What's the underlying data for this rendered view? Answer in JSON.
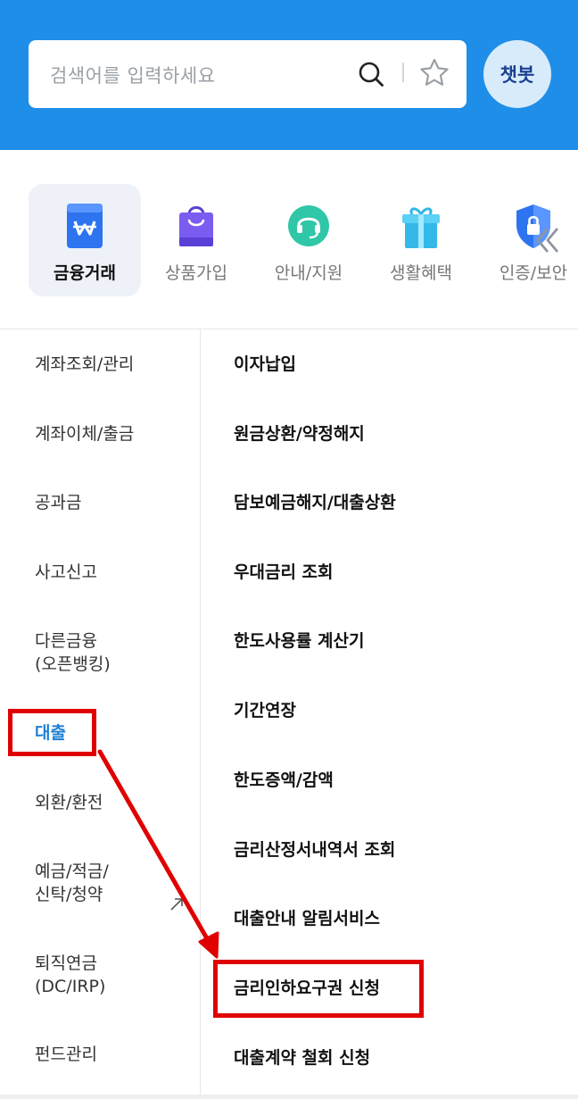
{
  "header": {
    "search_placeholder": "검색어를 입력하세요",
    "search_icon": "search-icon",
    "favorite_icon": "star-icon",
    "chatbot_label": "챗봇",
    "background_color": "#1f8ee8"
  },
  "categories": [
    {
      "label": "금융거래",
      "icon": "wallet-won-icon",
      "active": true
    },
    {
      "label": "상품가입",
      "icon": "shopping-bag-icon",
      "active": false
    },
    {
      "label": "안내/지원",
      "icon": "headset-icon",
      "active": false
    },
    {
      "label": "생활혜택",
      "icon": "gift-icon",
      "active": false
    },
    {
      "label": "인증/보안",
      "icon": "shield-lock-icon",
      "active": false
    }
  ],
  "left_menu": [
    {
      "label": "계좌조회/관리",
      "active": false
    },
    {
      "label": "계좌이체/출금",
      "active": false
    },
    {
      "label": "공과금",
      "active": false
    },
    {
      "label": "사고신고",
      "active": false
    },
    {
      "label_line1": "다른금융",
      "label_line2": "(오픈뱅킹)",
      "active": false
    },
    {
      "label": "대출",
      "active": true
    },
    {
      "label": "외환/환전",
      "active": false
    },
    {
      "label_line1": "예금/적금/",
      "label_line2": "신탁/청약",
      "active": false
    },
    {
      "label_line1": "퇴직연금",
      "label_line2": "(DC/IRP)",
      "active": false,
      "external": true
    },
    {
      "label": "펀드관리",
      "active": false
    }
  ],
  "right_menu": [
    {
      "label": "이자납입"
    },
    {
      "label": "원금상환/약정해지"
    },
    {
      "label": "담보예금해지/대출상환"
    },
    {
      "label": "우대금리 조회"
    },
    {
      "label": "한도사용률 계산기"
    },
    {
      "label": "기간연장"
    },
    {
      "label": "한도증액/감액"
    },
    {
      "label": "금리산정서내역서 조회"
    },
    {
      "label": "대출안내 알림서비스"
    },
    {
      "label": "금리인하요구권 신청"
    },
    {
      "label": "대출계약 철회 신청"
    }
  ],
  "colors": {
    "accent": "#1d7fd6",
    "annotation": "#e00000"
  }
}
